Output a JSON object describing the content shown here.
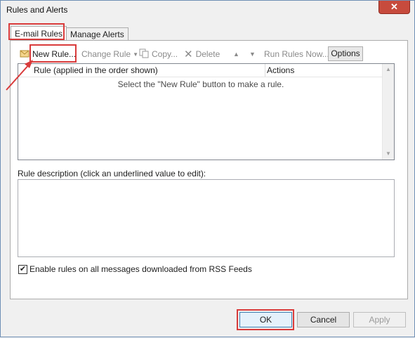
{
  "window": {
    "title": "Rules and Alerts"
  },
  "tabs": [
    {
      "label": "E-mail Rules"
    },
    {
      "label": "Manage Alerts"
    }
  ],
  "toolbar": {
    "new_rule": "New Rule...",
    "change_rule": "Change Rule",
    "copy": "Copy...",
    "delete": "Delete",
    "run_rules_now": "Run Rules Now...",
    "options": "Options"
  },
  "rules_list": {
    "columns": [
      "Rule (applied in the order shown)",
      "Actions"
    ],
    "empty_message": "Select the \"New Rule\" button to make a rule."
  },
  "rule_description": {
    "label": "Rule description (click an underlined value to edit):"
  },
  "rss_option": {
    "label": "Enable rules on all messages downloaded from RSS Feeds",
    "checked": true
  },
  "buttons": {
    "ok": "OK",
    "cancel": "Cancel",
    "apply": "Apply"
  },
  "colors": {
    "highlight": "#d93b3b",
    "close": "#c74b3d"
  },
  "icons": [
    "new-rule-icon",
    "copy-icon",
    "delete-icon",
    "move-up-icon",
    "move-down-icon",
    "close-icon"
  ]
}
